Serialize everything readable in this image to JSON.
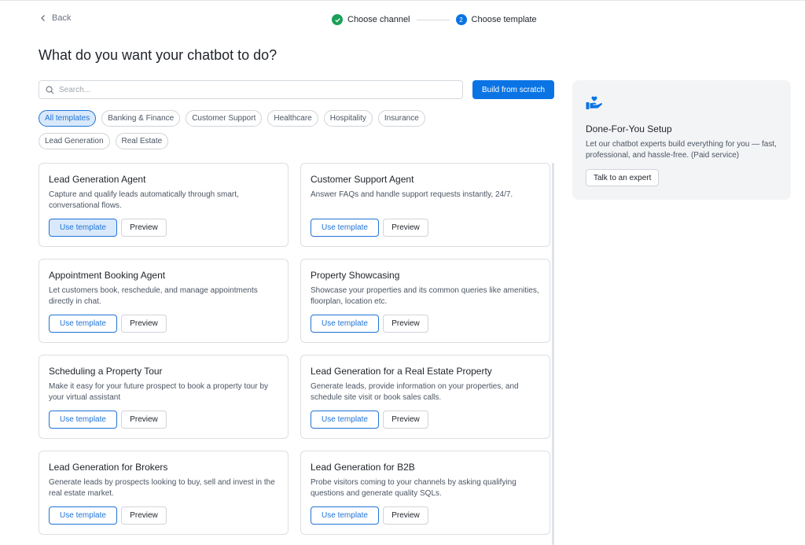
{
  "nav": {
    "back_label": "Back"
  },
  "stepper": {
    "step1": {
      "label": "Choose channel",
      "state": "done"
    },
    "step2": {
      "number": "2",
      "label": "Choose template",
      "state": "active"
    }
  },
  "page_title": "What do you want your chatbot to do?",
  "search": {
    "placeholder": "Search...",
    "value": ""
  },
  "build_from_scratch_label": "Build from scratch",
  "filters": [
    {
      "label": "All templates",
      "active": true
    },
    {
      "label": "Banking & Finance",
      "active": false
    },
    {
      "label": "Customer Support",
      "active": false
    },
    {
      "label": "Healthcare",
      "active": false
    },
    {
      "label": "Hospitality",
      "active": false
    },
    {
      "label": "Insurance",
      "active": false
    },
    {
      "label": "Lead Generation",
      "active": false
    },
    {
      "label": "Real Estate",
      "active": false
    }
  ],
  "templates": [
    {
      "title": "Lead Generation Agent",
      "description": "Capture and qualify leads automatically through smart, conversational flows.",
      "use_label": "Use template",
      "preview_label": "Preview"
    },
    {
      "title": "Customer Support Agent",
      "description": "Answer FAQs and handle support requests instantly, 24/7.",
      "use_label": "Use template",
      "preview_label": "Preview"
    },
    {
      "title": "Appointment Booking Agent",
      "description": "Let customers book, reschedule, and manage appointments directly in chat.",
      "use_label": "Use template",
      "preview_label": "Preview"
    },
    {
      "title": "Property Showcasing",
      "description": "Showcase your properties and its common queries like amenities, floorplan, location etc.",
      "use_label": "Use template",
      "preview_label": "Preview"
    },
    {
      "title": "Scheduling a Property Tour",
      "description": "Make it easy for your future prospect to book a property tour by your virtual assistant",
      "use_label": "Use template",
      "preview_label": "Preview"
    },
    {
      "title": "Lead Generation for a Real Estate Property",
      "description": "Generate leads, provide information on your properties, and schedule site visit or book sales calls.",
      "use_label": "Use template",
      "preview_label": "Preview"
    },
    {
      "title": "Lead Generation for Brokers",
      "description": "Generate leads by prospects looking to buy, sell and invest in the real estate market.",
      "use_label": "Use template",
      "preview_label": "Preview"
    },
    {
      "title": "Lead Generation for B2B",
      "description": "Probe visitors coming to your channels by asking qualifying questions and generate quality SQLs.",
      "use_label": "Use template",
      "preview_label": "Preview"
    }
  ],
  "done_for_you": {
    "icon": "hand-heart-icon",
    "title": "Done-For-You Setup",
    "description": "Let our chatbot experts build everything for you — fast, professional, and hassle-free. (Paid service)",
    "button_label": "Talk to an expert"
  },
  "colors": {
    "primary": "#0b74e5",
    "success": "#1aa058",
    "chip_active_bg": "#d9e9fb"
  }
}
